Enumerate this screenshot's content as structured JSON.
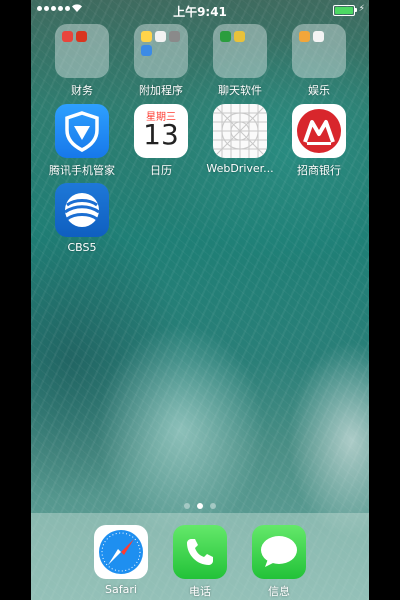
{
  "status_bar": {
    "time": "上午9:41",
    "battery_color": "#4cd964"
  },
  "home": {
    "apps": [
      {
        "label": "财务",
        "type": "folder"
      },
      {
        "label": "附加程序",
        "type": "folder"
      },
      {
        "label": "聊天软件",
        "type": "folder"
      },
      {
        "label": "娱乐",
        "type": "folder"
      },
      {
        "label": "腾讯手机管家",
        "type": "app",
        "icon": "tencent-shield-icon"
      },
      {
        "label": "日历",
        "type": "app",
        "icon": "calendar-icon"
      },
      {
        "label": "WebDriver...",
        "type": "app",
        "icon": "webdriver-grid-icon"
      },
      {
        "label": "招商银行",
        "type": "app",
        "icon": "cmb-bank-icon"
      },
      {
        "label": "CBS5",
        "type": "app",
        "icon": "cbs-globe-icon"
      }
    ],
    "calendar": {
      "weekday": "星期三",
      "day": "13"
    },
    "page_indicator": {
      "pages": 3,
      "current": 2
    }
  },
  "dock": {
    "apps": [
      {
        "label": "Safari",
        "icon": "safari-compass-icon"
      },
      {
        "label": "电话",
        "icon": "phone-icon"
      },
      {
        "label": "信息",
        "icon": "messages-bubble-icon"
      }
    ]
  }
}
